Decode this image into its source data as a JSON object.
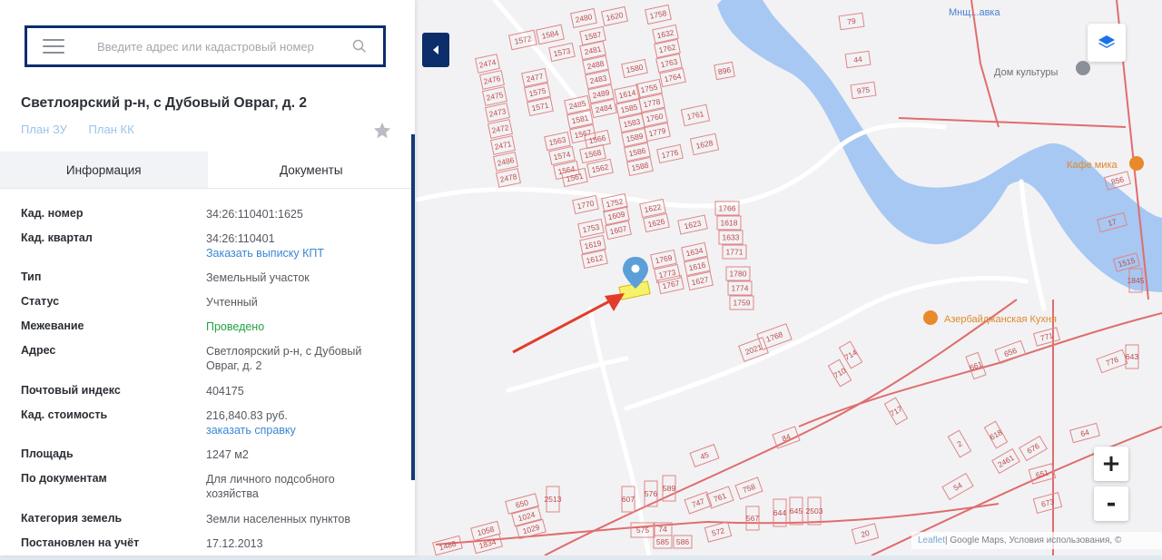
{
  "search": {
    "placeholder": "Введите адрес или кадастровый номер"
  },
  "parcel": {
    "title": "Светлоярский р-н, с Дубовый Овраг, д. 2",
    "links": [
      "План ЗУ",
      "План КК"
    ]
  },
  "tabs": [
    "Информация",
    "Документы"
  ],
  "properties": [
    {
      "label": "Кад. номер",
      "value": "34:26:110401:1625"
    },
    {
      "label": "Кад. квартал",
      "value": "34:26:110401",
      "link": "Заказать выписку КПТ"
    },
    {
      "label": "Тип",
      "value": "Земельный участок"
    },
    {
      "label": "Статус",
      "value": "Учтенный"
    },
    {
      "label": "Межевание",
      "value": "Проведено"
    },
    {
      "label": "Адрес",
      "value": "Светлоярский р-н, с Дубовый Овраг, д. 2"
    },
    {
      "label": "Почтовый индекс",
      "value": "404175"
    },
    {
      "label": "Кад. стоимость",
      "value": "216,840.83 руб.",
      "link": "заказать справку"
    },
    {
      "label": "Площадь",
      "value": "1247 м2"
    },
    {
      "label": "По документам",
      "value": "Для личного подсобного хозяйства"
    },
    {
      "label": "Категория земель",
      "value": "Земли населенных пунктов"
    },
    {
      "label": "Постановлен на учёт",
      "value": "17.12.2013"
    }
  ],
  "map": {
    "zoom_in": "+",
    "zoom_out": "-",
    "attribution_leaflet": "Leaflet",
    "attribution_rest": " | Google Maps, Условия использования, ©",
    "poi": [
      "Кафе мика",
      "Азербайджанская Кухня",
      "Дом культуры",
      "Мнщ...авка"
    ],
    "highlight_color": "#f7f26b",
    "water_color": "#a7c8f2",
    "plot_color": "#e08585",
    "accent_color": "#0b2e6b",
    "plots": [
      {
        "n": "1572"
      },
      {
        "n": "1584"
      },
      {
        "n": "2480"
      },
      {
        "n": "1620"
      },
      {
        "n": "1758"
      },
      {
        "n": "2474"
      },
      {
        "n": "2476"
      },
      {
        "n": "2475"
      },
      {
        "n": "2473"
      },
      {
        "n": "2472"
      },
      {
        "n": "2471"
      },
      {
        "n": "2486"
      },
      {
        "n": "2478"
      },
      {
        "n": "2477"
      },
      {
        "n": "1575"
      },
      {
        "n": "1571"
      },
      {
        "n": "1573"
      },
      {
        "n": "1587"
      },
      {
        "n": "2481"
      },
      {
        "n": "2488"
      },
      {
        "n": "2483"
      },
      {
        "n": "2489"
      },
      {
        "n": "2484"
      },
      {
        "n": "2485"
      },
      {
        "n": "1581"
      },
      {
        "n": "1567"
      },
      {
        "n": "1566"
      },
      {
        "n": "1563"
      },
      {
        "n": "1574"
      },
      {
        "n": "1564"
      },
      {
        "n": "1561"
      },
      {
        "n": "1568"
      },
      {
        "n": "1562"
      },
      {
        "n": "1580"
      },
      {
        "n": "1614"
      },
      {
        "n": "1585"
      },
      {
        "n": "1583"
      },
      {
        "n": "1589"
      },
      {
        "n": "1586"
      },
      {
        "n": "1588"
      },
      {
        "n": "1755"
      },
      {
        "n": "1778"
      },
      {
        "n": "1760"
      },
      {
        "n": "1779"
      },
      {
        "n": "1776"
      },
      {
        "n": "1632"
      },
      {
        "n": "1762"
      },
      {
        "n": "1763"
      },
      {
        "n": "1764"
      },
      {
        "n": "1761"
      },
      {
        "n": "1628"
      },
      {
        "n": "1770"
      },
      {
        "n": "1752"
      },
      {
        "n": "1622"
      },
      {
        "n": "1609"
      },
      {
        "n": "1626"
      },
      {
        "n": "1753"
      },
      {
        "n": "1607"
      },
      {
        "n": "1619"
      },
      {
        "n": "1612"
      },
      {
        "n": "1623"
      },
      {
        "n": "1766"
      },
      {
        "n": "1618"
      },
      {
        "n": "1633"
      },
      {
        "n": "1771"
      },
      {
        "n": "1769"
      },
      {
        "n": "1634"
      },
      {
        "n": "1773"
      },
      {
        "n": "1616"
      },
      {
        "n": "1767"
      },
      {
        "n": "1627"
      },
      {
        "n": "1780"
      },
      {
        "n": "1774"
      },
      {
        "n": "1759"
      },
      {
        "n": "1768"
      },
      {
        "n": "2021"
      },
      {
        "n": "79"
      },
      {
        "n": "44"
      },
      {
        "n": "975"
      },
      {
        "n": "896"
      },
      {
        "n": "17"
      },
      {
        "n": "856"
      },
      {
        "n": "776"
      },
      {
        "n": "656"
      },
      {
        "n": "661"
      },
      {
        "n": "710"
      },
      {
        "n": "714"
      },
      {
        "n": "717"
      },
      {
        "n": "84"
      },
      {
        "n": "45"
      },
      {
        "n": "758"
      },
      {
        "n": "761"
      },
      {
        "n": "747"
      },
      {
        "n": "567"
      },
      {
        "n": "644"
      },
      {
        "n": "645"
      },
      {
        "n": "2503"
      },
      {
        "n": "650"
      },
      {
        "n": "1024"
      },
      {
        "n": "1029"
      },
      {
        "n": "1058"
      },
      {
        "n": "1834"
      },
      {
        "n": "1488"
      },
      {
        "n": "2513"
      },
      {
        "n": "607"
      },
      {
        "n": "576"
      },
      {
        "n": "589"
      },
      {
        "n": "575"
      },
      {
        "n": "74"
      },
      {
        "n": "585"
      },
      {
        "n": "586"
      },
      {
        "n": "572"
      },
      {
        "n": "20"
      },
      {
        "n": "54"
      },
      {
        "n": "2461"
      },
      {
        "n": "651"
      },
      {
        "n": "673"
      },
      {
        "n": "676"
      },
      {
        "n": "64"
      },
      {
        "n": "2"
      },
      {
        "n": "618"
      },
      {
        "n": "643"
      },
      {
        "n": "1845"
      },
      {
        "n": "1515"
      },
      {
        "n": "771"
      },
      {
        "n": "63"
      }
    ]
  }
}
